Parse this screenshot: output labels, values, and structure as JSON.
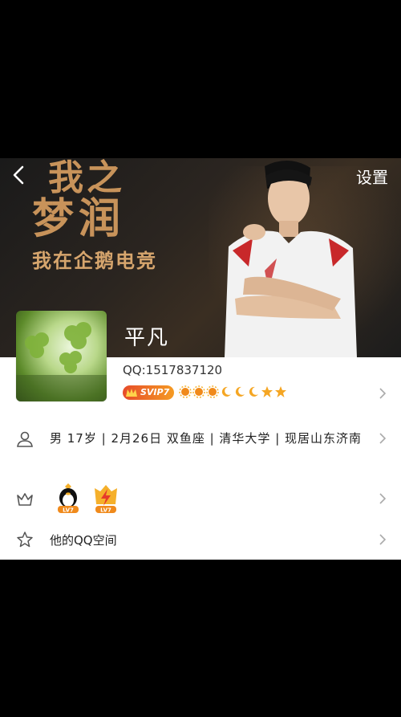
{
  "header": {
    "settings_label": "设置"
  },
  "banner": {
    "slogan_line1": "我之",
    "slogan_line2": "梦润",
    "slogan_line3": "我在企鹅电竞"
  },
  "profile": {
    "username": "平凡",
    "qq_number": "QQ:1517837120",
    "vip_label": "SVIP7",
    "info_text": "男  17岁 | 2月26日  双鱼座 | 清华大学 | 现居山东济南"
  },
  "badges": [
    {
      "name": "qq-penguin-badge",
      "label": "LV7"
    },
    {
      "name": "lightning-badge",
      "label": "LV7"
    }
  ],
  "qzone": {
    "label": "他的QQ空间"
  },
  "colors": {
    "vip_gradient_start": "#e64b2a",
    "vip_gradient_end": "#f59b23",
    "slogan": "#c8935a"
  }
}
